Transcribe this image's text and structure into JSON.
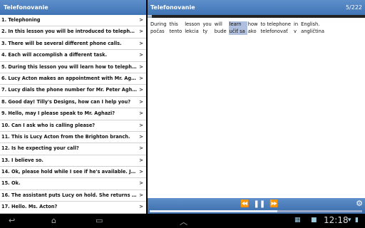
{
  "left_panel": {
    "title": "Telefonovanie",
    "lessons": [
      "1. Telephoning",
      "2. In this lesson you will be introduced to telephoning",
      "3. There will be several different phone calls.",
      "4. Each will accomplish a different task.",
      "5. During this lesson you will learn how to telephone",
      "6. Lucy Acton makes an appointment with Mr. Aghazi.",
      "7. Lucy dials the phone number for Mr. Peter Aghazi's",
      "8. Good day! Tilly's Designs, how can I help you?",
      "9. Hello, may I please speak to Mr. Aghazi?",
      "10. Can I ask who is calling please?",
      "11. This is Lucy Acton from the Brighton branch.",
      "12. Is he expecting your call?",
      "13. I believe so.",
      "14. Ok, please hold while I see if he's available. Just",
      "15. Ok.",
      "16. The assistant puts Lucy on hold. She returns in t",
      "17. Hello. Ms. Acton?"
    ],
    "chevron": ">"
  },
  "right_panel": {
    "title": "Telefonovanie",
    "counter": "5/222",
    "progress": 0.02,
    "playback_progress": 0.6,
    "words": [
      {
        "en": "During",
        "sk": "počas"
      },
      {
        "en": "this",
        "sk": "tento"
      },
      {
        "en": "lesson",
        "sk": "lekcia"
      },
      {
        "en": "you",
        "sk": "ty"
      },
      {
        "en": "will",
        "sk": "bude"
      },
      {
        "en": "learn",
        "sk": "učiť sa"
      },
      {
        "en": "how",
        "sk": "ako"
      },
      {
        "en": "to telephone",
        "sk": "telefonovať"
      },
      {
        "en": "in",
        "sk": "v"
      },
      {
        "en": "English.",
        "sk": "angličtina"
      }
    ],
    "highlighted_word_index": 5,
    "controls": {
      "rewind": "⏪",
      "pause": "❚❚",
      "forward": "⏩",
      "settings": "⚙"
    }
  },
  "system_bar": {
    "time": "12:18",
    "nav_icons": [
      "back-icon",
      "home-icon",
      "recent-apps-icon",
      "up-arrow-icon"
    ]
  }
}
